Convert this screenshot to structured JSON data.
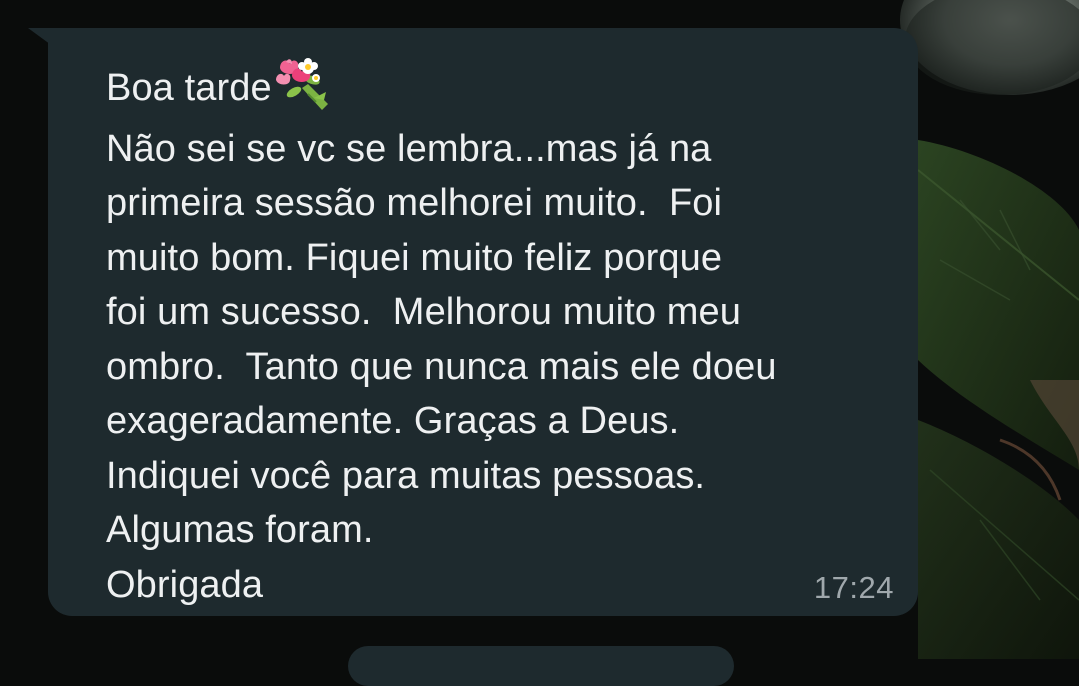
{
  "chat": {
    "message": {
      "greeting": "Boa tarde",
      "greeting_emoji": "bouquet-icon",
      "lines": [
        "Não sei se vc se lembra...mas já na",
        "primeira sessão melhorei muito.  Foi",
        "muito bom. Fiquei muito feliz porque",
        "foi um sucesso.  Melhorou muito meu",
        "ombro.  Tanto que nunca mais ele doeu",
        "exageradamente. Graças a Deus.",
        "Indiquei você para muitas pessoas.",
        "Algumas foram.",
        "Obrigada"
      ],
      "time": "17:24"
    }
  },
  "colors": {
    "bubble_background": "#1e2a2e",
    "text": "#eef0f1",
    "timestamp": "#a0a8ac",
    "wallpaper": "#0a0c0b"
  }
}
